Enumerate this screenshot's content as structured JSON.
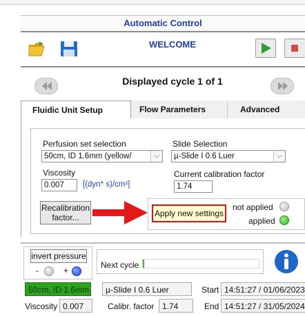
{
  "app": {
    "title": "Automatic Control",
    "welcome": "WELCOME"
  },
  "toolbar": {
    "open_icon": "folder-open-icon",
    "save_icon": "floppy-save-icon",
    "play_icon": "play-icon",
    "stop_icon": "stop-icon"
  },
  "cycle": {
    "title": "Displayed cycle 1 of 1",
    "prev_icon": "rewind-icon",
    "next_icon": "fast-forward-icon"
  },
  "tabs": [
    {
      "label": "Fluidic Unit Setup",
      "active": true
    },
    {
      "label": "Flow Parameters",
      "active": false
    },
    {
      "label": "Advanced",
      "active": false
    }
  ],
  "setup": {
    "perfusion_label": "Perfusion set selection",
    "perfusion_value": "50cm, ID 1.6mm (yellow/",
    "slide_label": "Slide Selection",
    "slide_value": "µ-Slide I 0.6 Luer",
    "viscosity_label": "Viscosity",
    "viscosity_value": "0.007",
    "viscosity_unit": "[(dyn* s)/cm²]",
    "calib_label": "Current calibration factor",
    "calib_value": "1.74",
    "recal_button": "Recalibration factor..."
  },
  "apply": {
    "button": "Apply new settings",
    "not_applied": "not applied",
    "applied": "applied",
    "colors": {
      "not_applied": "#cfcfcf",
      "applied": "#3fbf2a",
      "highlight": "#d11616",
      "arrow": "#e31818"
    }
  },
  "bottom": {
    "invert_label": "invert pressure",
    "minus": "-",
    "plus": "+",
    "next_cycle_label": "Next cycle",
    "info_icon": "info-icon",
    "perfusion_status": "50cm, ID 1.6mm",
    "slide_status": "µ-Slide I 0.6 Luer",
    "start_label": "Start",
    "start_value": "14:51:27 / 01/06/2023",
    "viscosity_label": "Viscosity",
    "viscosity_value": "0.007",
    "calib_label": "Calibr. factor",
    "calib_value": "1.74",
    "end_label": "End",
    "end_value": "14:51:27 / 31/05/2024"
  }
}
